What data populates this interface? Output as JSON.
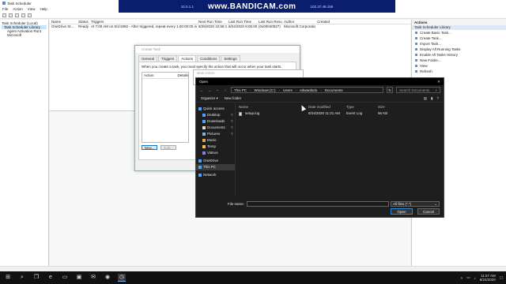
{
  "banner": {
    "ip_left": "10.0.1.1",
    "brand": "www.BANDICAM.com",
    "ip_right": "102.37.49.155"
  },
  "app": {
    "title": "Task Scheduler"
  },
  "menu": [
    "File",
    "Action",
    "View",
    "Help"
  ],
  "tree": [
    "Task Scheduler (Local)",
    "Task Scheduler Library",
    "Agent Activation Runt",
    "Microsoft"
  ],
  "tasks": {
    "columns": [
      "Name",
      "Status",
      "Triggers",
      "Next Run Time",
      "Last Run Time",
      "Last Run Result",
      "Author",
      "Created"
    ],
    "rows": [
      [
        "OneDrive St...",
        "Ready",
        "At 7:00 AM on 5/1/1992 - After triggered, repeat every 1.00:00:00 indefinitely.",
        "8/25/2020 10:56:15 AM",
        "8/24/2020 8:05:00 AM",
        "(0x00040027)",
        "Microsoft Corporation",
        ""
      ]
    ]
  },
  "actions_panel": {
    "header": "Actions",
    "section": "Task Scheduler Library",
    "items": [
      "Create Basic Task...",
      "Create Task...",
      "Import Task...",
      "Display All Running Tasks",
      "Enable All Tasks History",
      "New Folder...",
      "View",
      "Refresh"
    ]
  },
  "create_task": {
    "title": "Create Task",
    "tabs": [
      "General",
      "Triggers",
      "Actions",
      "Conditions",
      "Settings"
    ],
    "active_tab": "Actions",
    "hint": "When you create a task, you must specify the action that will occur when your task starts.",
    "list_columns": [
      "Action",
      "Details"
    ],
    "buttons": [
      "New...",
      "Edit..."
    ]
  },
  "new_action": {
    "title": "New Action"
  },
  "open_dialog": {
    "title": "Open",
    "path": [
      "This PC",
      "Windows (C:)",
      "Users",
      "edwardsdo",
      "Documents"
    ],
    "search_placeholder": "Search Documents",
    "organize": "Organize",
    "new_folder": "New folder",
    "nav": [
      {
        "label": "Quick access",
        "icon": "star-icon",
        "color": "#4aa3ff"
      },
      {
        "label": "Desktop",
        "icon": "desktop-icon",
        "color": "#4aa3ff",
        "pinned": true
      },
      {
        "label": "Downloads",
        "icon": "download-icon",
        "color": "#4aa3ff",
        "pinned": true
      },
      {
        "label": "Documents",
        "icon": "documents-icon",
        "color": "#d9d9d9",
        "pinned": true
      },
      {
        "label": "Pictures",
        "icon": "pictures-icon",
        "color": "#7fb3e6",
        "pinned": true
      },
      {
        "label": "Music",
        "icon": "music-icon",
        "color": "#e8a34a"
      },
      {
        "label": "Temp",
        "icon": "folder-icon",
        "color": "#e8c34a"
      },
      {
        "label": "Videos",
        "icon": "videos-icon",
        "color": "#8a7ce8"
      },
      {
        "label": "OneDrive",
        "icon": "cloud-icon",
        "color": "#4aa3ff"
      },
      {
        "label": "This PC",
        "icon": "computer-icon",
        "color": "#4aa3ff"
      },
      {
        "label": "Network",
        "icon": "network-icon",
        "color": "#4aa3ff"
      }
    ],
    "file_columns": [
      "Name",
      "Date modified",
      "Type",
      "Size"
    ],
    "files": [
      {
        "name": "setup.log",
        "date": "8/24/2020 11:21 AM",
        "type": "Event Log",
        "size": "66 KB"
      }
    ],
    "file_name_label": "File name:",
    "file_name_value": "",
    "file_type": "All files (*.*)",
    "open_label": "Open",
    "cancel_label": "Cancel"
  },
  "taskbar": {
    "time": "11:57 AM",
    "date": "8/24/2020"
  }
}
